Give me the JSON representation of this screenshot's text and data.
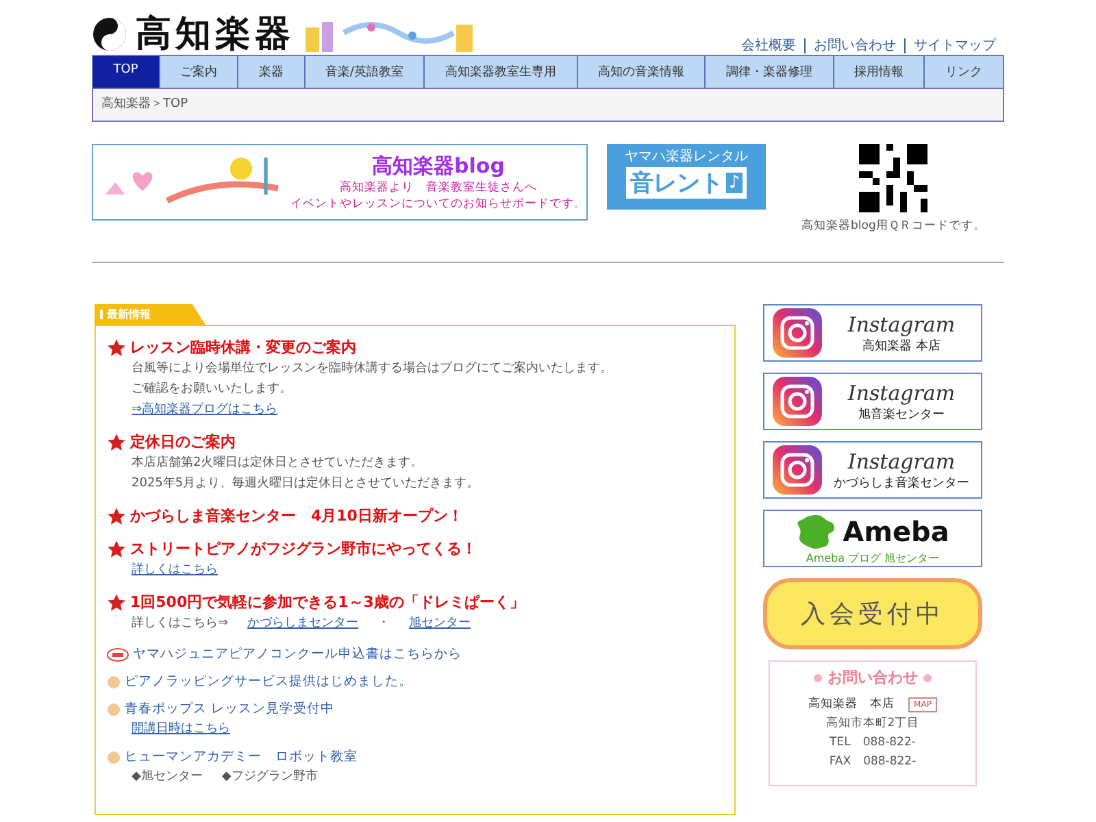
{
  "header": {
    "logo": "高知楽器",
    "links": [
      "会社概要",
      "お問い合わせ",
      "サイトマップ"
    ]
  },
  "nav": [
    {
      "label": "TOP",
      "selected": true
    },
    {
      "label": "ご案内",
      "selected": false
    },
    {
      "label": "楽器",
      "selected": false
    },
    {
      "label": "音楽/英語教室",
      "selected": false
    },
    {
      "label": "高知楽器教室生専用",
      "selected": false
    },
    {
      "label": "高知の音楽情報",
      "selected": false
    },
    {
      "label": "調律・楽器修理",
      "selected": false
    },
    {
      "label": "採用情報",
      "selected": false
    },
    {
      "label": "リンク",
      "selected": false
    }
  ],
  "breadcrumb": "高知楽器＞TOP",
  "banners": {
    "blog": {
      "title": "高知楽器blog",
      "lines": [
        "高知楽器より　音楽教室生徒さんへ",
        "イベントやレッスンについてのお知らせボードです。"
      ]
    },
    "rental": {
      "top": "ヤマハ楽器レンタル",
      "main": "音レント",
      "note": "♪"
    },
    "qr_caption": "高知楽器blog用ＱＲコードです。"
  },
  "news": {
    "heading": "最新情報",
    "items": [
      {
        "kind": "star",
        "title": "レッスン臨時休講・変更のご案内",
        "lines": [
          [
            {
              "text": "台風等により会場単位でレッスンを臨時休講する場合はブログにてご案内いたします。",
              "link": false
            }
          ],
          [
            {
              "text": "ご確認をお願いいたします。",
              "link": false
            }
          ],
          [
            {
              "text": "⇒高知楽器ブログはこちら",
              "link": true
            }
          ]
        ]
      },
      {
        "kind": "star",
        "title": "定休日のご案内",
        "lines": [
          [
            {
              "text": "本店店舗第2火曜日は定休日とさせていただきます。",
              "link": false
            }
          ],
          [
            {
              "text": "2025年5月より、毎週火曜日は定休日とさせていただきます。",
              "link": false
            }
          ]
        ]
      },
      {
        "kind": "star",
        "title": "かづらしま音楽センター　4月10日新オープン！"
      },
      {
        "kind": "star",
        "title": "ストリートピアノがフジグラン野市にやってくる！",
        "lines": [
          [
            {
              "text": "詳しくはこちら",
              "link": true
            }
          ]
        ]
      },
      {
        "kind": "star",
        "title": "1回500円で気軽に参加できる1～3歳の「ドレミぱーく」",
        "lines": [
          [
            {
              "text": "詳しくはこちら⇒",
              "link": false
            },
            {
              "text": "かづらしまセンター",
              "link": true
            },
            {
              "text": "・",
              "link": false
            },
            {
              "text": "旭センター",
              "link": true
            }
          ]
        ]
      },
      {
        "kind": "new",
        "title": "ヤマハジュニアピアノコンクール申込書はこちらから"
      },
      {
        "kind": "bullet",
        "title": "ピアノラッピングサービス提供はじめました。"
      },
      {
        "kind": "bullet",
        "title": "青春ポップス レッスン見学受付中",
        "lines": [
          [
            {
              "text": "開講日時はこちら",
              "link": true
            }
          ]
        ]
      },
      {
        "kind": "bullet",
        "title": "ヒューマンアカデミー　ロボット教室",
        "lines": [
          [
            {
              "text": "◆旭センター",
              "link": false
            },
            {
              "text": "◆フジグラン野市",
              "link": false
            }
          ]
        ]
      }
    ]
  },
  "sidebar": {
    "instagram": [
      {
        "brand": "Instagram",
        "label": "高知楽器 本店"
      },
      {
        "brand": "Instagram",
        "label": "旭音楽センター"
      },
      {
        "brand": "Instagram",
        "label": "かづらしま音楽センター"
      }
    ],
    "ameba": {
      "brand": "Ameba",
      "label": "Ameba ブログ 旭センター"
    },
    "recruit": "入会受付中",
    "contact": {
      "title": "お問い合わせ",
      "store": "高知楽器　本店",
      "map": "MAP",
      "lines": [
        "高知市本町2丁目",
        "TEL　088-822-",
        "FAX　088-822-"
      ]
    }
  }
}
